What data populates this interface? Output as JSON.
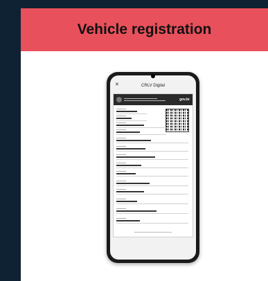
{
  "banner": {
    "title": "Vehicle registration"
  },
  "phone": {
    "app_title": "CRLV Digital",
    "close_glyph": "✕",
    "doc_brand": "gov.br"
  },
  "colors": {
    "background": "#0f2234",
    "banner": "#e8505b"
  }
}
